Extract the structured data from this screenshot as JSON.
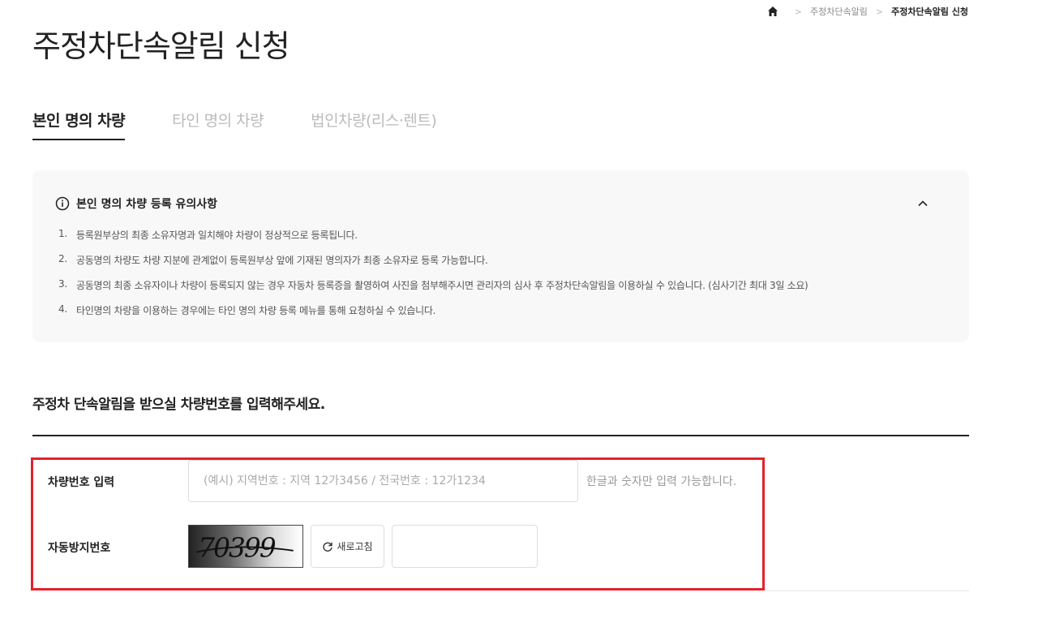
{
  "breadcrumb": {
    "home_icon": "home-icon",
    "items": [
      "주정차단속알림",
      "주정차단속알림 신청"
    ]
  },
  "page_title": "주정차단속알림 신청",
  "tabs": [
    {
      "label": "본인 명의 차량",
      "active": true
    },
    {
      "label": "타인 명의 차량",
      "active": false
    },
    {
      "label": "법인차량(리스·렌트)",
      "active": false
    }
  ],
  "notice": {
    "title": "본인 명의 차량 등록 유의사항",
    "icon": "info-icon",
    "collapse_icon": "chevron-up-icon",
    "items": [
      {
        "num": "1.",
        "text": "등록원부상의 최종 소유자명과 일치해야 차량이 정상적으로 등록됩니다."
      },
      {
        "num": "2.",
        "text": "공동명의 차량도 차량 지분에 관계없이 등록원부상 앞에 기재된 명의자가 최종 소유자로 등록 가능합니다."
      },
      {
        "num": "3.",
        "text": "공동명의 최종 소유자이나 차량이 등록되지 않는 경우 자동차 등록증을 촬영하여 사진을 첨부해주시면 관리자의 심사 후 주정차단속알림을 이용하실 수 있습니다. (심사기간 최대 3일 소요)"
      },
      {
        "num": "4.",
        "text": "타인명의 차량을 이용하는 경우에는 타인 명의 차량 등록 메뉴를 통해 요청하실 수 있습니다."
      }
    ]
  },
  "section_title": "주정차 단속알림을 받으실 차량번호를 입력해주세요.",
  "form": {
    "plate_label": "차량번호 입력",
    "plate_placeholder": "(예시) 지역번호 : 지역 12가3456 / 전국번호 : 12가1234",
    "plate_hint": "한글과 숫자만 입력 가능합니다.",
    "captcha_label": "자동방지번호",
    "captcha_text": "70399",
    "refresh_label": "새로고침",
    "refresh_icon": "refresh-icon",
    "captcha_value": ""
  },
  "colors": {
    "highlight_border": "#e5222a",
    "notice_bg": "#f8f8f8"
  }
}
